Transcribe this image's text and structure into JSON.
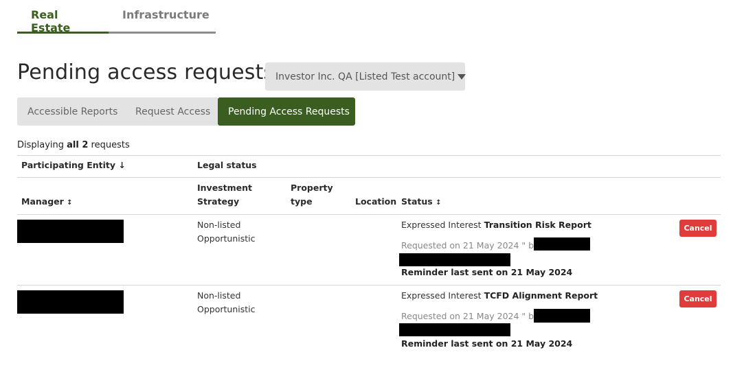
{
  "top_tabs": [
    {
      "label": "Real Estate",
      "active": true
    },
    {
      "label": "Infrastructure",
      "active": false
    }
  ],
  "page_title": "Pending access requests",
  "account_selector": {
    "value": "Investor Inc. QA [Listed Test account]",
    "icon": "caret-down-icon"
  },
  "sub_tabs": [
    {
      "label": "Accessible Reports",
      "active": false
    },
    {
      "label": "Request Access",
      "active": false
    },
    {
      "label": "Pending Access Requests",
      "active": true
    }
  ],
  "count": {
    "prefix": "Displaying ",
    "bold": "all 2",
    "suffix": " requests"
  },
  "table": {
    "header_row1": {
      "participating_entity": "Participating Entity",
      "sort_icon": "↓",
      "legal_status": "Legal status"
    },
    "header_row2": {
      "manager": "Manager",
      "manager_sort": "↕",
      "investment_strategy_line1": "Investment",
      "investment_strategy_line2": "Strategy",
      "property_type_line1": "Property",
      "property_type_line2": "type",
      "location": "Location",
      "status": "Status",
      "status_sort": "↕"
    },
    "rows": [
      {
        "legal_status": "Non-listed",
        "strategy": "Opportunistic",
        "status_prefix": "Expressed Interest ",
        "report": "Transition Risk Report",
        "requested": "Requested on 21 May 2024 \" by",
        "reminder": "Reminder last sent on 21 May 2024",
        "cancel_label": "Cancel"
      },
      {
        "legal_status": "Non-listed",
        "strategy": "Opportunistic",
        "status_prefix": "Expressed Interest ",
        "report": "TCFD Alignment Report",
        "requested": "Requested on 21 May 2024 \" by",
        "reminder": "Reminder last sent on 21 May 2024",
        "cancel_label": "Cancel"
      }
    ]
  },
  "colors": {
    "accent_green": "#3a5e1f",
    "cancel_red": "#e03c3c",
    "tab_gray": "#e3e3e3"
  }
}
